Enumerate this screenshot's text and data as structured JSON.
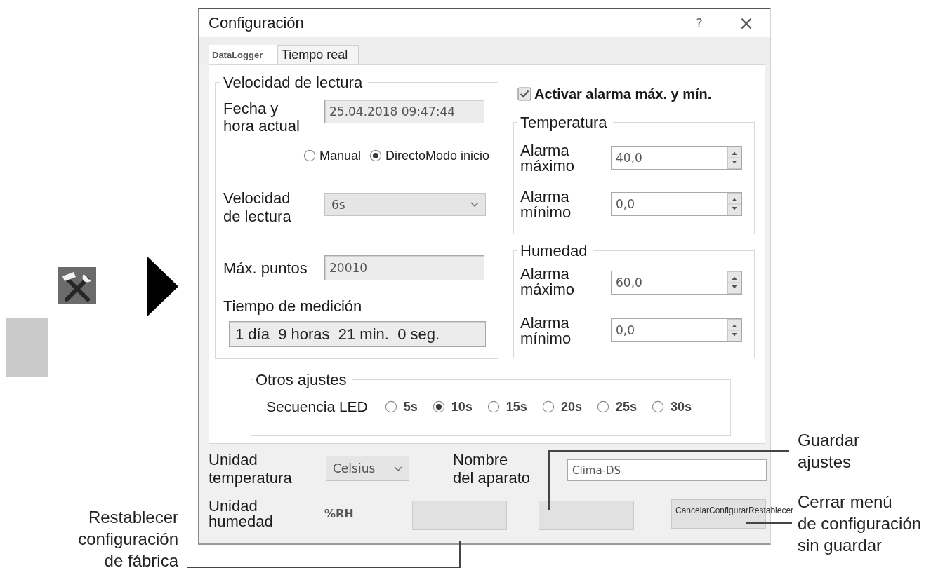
{
  "window": {
    "title": "Configuración",
    "help": "?",
    "close": "×"
  },
  "tabs": [
    {
      "label": "DataLogger",
      "selected": true
    },
    {
      "label": "Tiempo real",
      "selected": false
    }
  ],
  "reading": {
    "title": "Velocidad de lectura",
    "datetime": {
      "label": "Fecha y\nhora actual",
      "value": "25.04.2018 09:47:44"
    },
    "modes": [
      {
        "label": "Manual",
        "selected": false
      },
      {
        "label": "Directo",
        "selected": true
      }
    ],
    "mode_caption": "Modo inicio",
    "rate": {
      "label": "Velocidad\nde lectura",
      "value": "6s"
    },
    "max_points": {
      "label": "Máx. puntos",
      "value": "20010"
    },
    "duration": {
      "label": "Tiempo de medición",
      "value": "1 día  9 horas  21 min.  0 seg."
    }
  },
  "alarm": {
    "label": "Activar alarma máx. y mín.",
    "checked": true,
    "groups": [
      {
        "title": "Temperatura",
        "rows": [
          {
            "label": "Alarma\nmáximo",
            "value": "40,0"
          },
          {
            "label": "Alarma\nmínimo",
            "value": "0,0"
          }
        ]
      },
      {
        "title": "Humedad",
        "rows": [
          {
            "label": "Alarma\nmáximo",
            "value": "60,0"
          },
          {
            "label": "Alarma\nmínimo",
            "value": "0,0"
          }
        ]
      }
    ]
  },
  "other": {
    "title": "Otros ajustes",
    "label": "Secuencia LED",
    "options": [
      {
        "label": "5s",
        "selected": false
      },
      {
        "label": "10s",
        "selected": true
      },
      {
        "label": "15s",
        "selected": false
      },
      {
        "label": "20s",
        "selected": false
      },
      {
        "label": "25s",
        "selected": false
      },
      {
        "label": "30s",
        "selected": false
      }
    ]
  },
  "footer": {
    "temperature_unit": {
      "label": "Unidad\ntemperatura",
      "value": "Celsius"
    },
    "device_name": {
      "label": "Nombre\ndel aparato",
      "value": "Clima-DS"
    },
    "humidity_unit": {
      "label": "Unidad\nhumedad",
      "value": "%RH"
    },
    "button_labels": "CancelarConfigurarRestablecer"
  },
  "callouts": {
    "save": "Guardar\najustes",
    "reset": "Restablecer\nconfiguración\nde fábrica",
    "close": "Cerrar menú\nde configuración\nsin guardar"
  }
}
